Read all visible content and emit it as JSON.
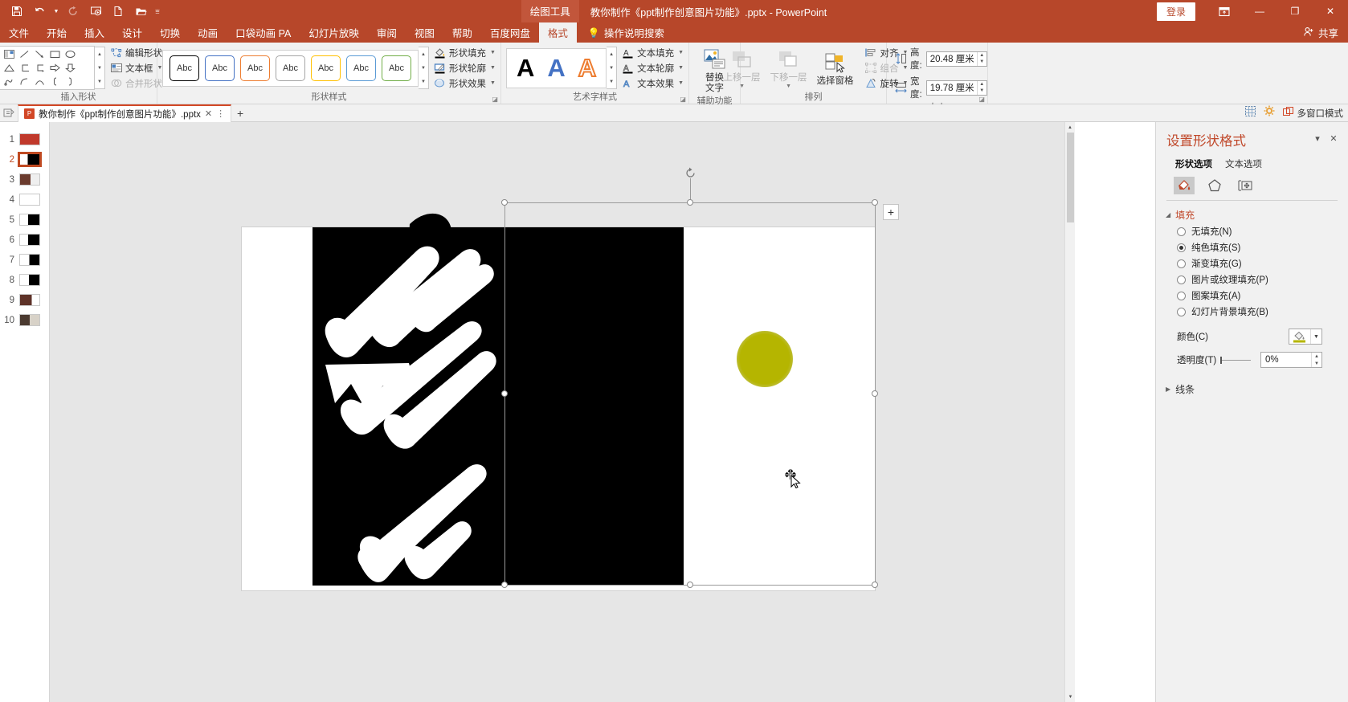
{
  "titlebar": {
    "quick_access": [
      {
        "name": "save-icon",
        "glyph": "save"
      },
      {
        "name": "undo-icon",
        "glyph": "undo"
      },
      {
        "name": "redo-icon",
        "glyph": "redo"
      },
      {
        "name": "start-slideshow-icon",
        "glyph": "slideshow"
      },
      {
        "name": "new-file-icon",
        "glyph": "file"
      },
      {
        "name": "open-folder-icon",
        "glyph": "folder"
      },
      {
        "name": "customize-qat-icon",
        "glyph": "caret"
      }
    ],
    "contextual_tab": "绘图工具",
    "document_title": "教你制作《ppt制作创意图片功能》.pptx  -  PowerPoint",
    "signin": "登录",
    "ribbon_display": "ribbon-options",
    "minimize": "—",
    "restore": "❐",
    "close": "✕"
  },
  "tabs": [
    {
      "label": "文件",
      "active": false
    },
    {
      "label": "开始",
      "active": false
    },
    {
      "label": "插入",
      "active": false
    },
    {
      "label": "设计",
      "active": false
    },
    {
      "label": "切换",
      "active": false
    },
    {
      "label": "动画",
      "active": false
    },
    {
      "label": "口袋动画 PA",
      "active": false
    },
    {
      "label": "幻灯片放映",
      "active": false
    },
    {
      "label": "审阅",
      "active": false
    },
    {
      "label": "视图",
      "active": false
    },
    {
      "label": "帮助",
      "active": false
    },
    {
      "label": "百度网盘",
      "active": false
    },
    {
      "label": "格式",
      "active": true
    }
  ],
  "tellme": "操作说明搜索",
  "share": "共享",
  "ribbon": {
    "groups": {
      "insert_shapes": {
        "label": "插入形状",
        "commands": [
          {
            "label": "编辑形状",
            "disabled": false,
            "caret": true
          },
          {
            "label": "文本框",
            "disabled": false,
            "caret": true
          },
          {
            "label": "合并形状",
            "disabled": true,
            "caret": true
          }
        ]
      },
      "shape_styles": {
        "label": "形状样式",
        "swatches": [
          {
            "text": "Abc",
            "color": "#000000"
          },
          {
            "text": "Abc",
            "color": "#4472c4"
          },
          {
            "text": "Abc",
            "color": "#ed7d31"
          },
          {
            "text": "Abc",
            "color": "#a5a5a5"
          },
          {
            "text": "Abc",
            "color": "#ffc000"
          },
          {
            "text": "Abc",
            "color": "#5b9bd5"
          },
          {
            "text": "Abc",
            "color": "#70ad47"
          }
        ],
        "commands": [
          {
            "label": "形状填充",
            "caret": true
          },
          {
            "label": "形状轮廓",
            "caret": true
          },
          {
            "label": "形状效果",
            "caret": true
          }
        ]
      },
      "wordart_styles": {
        "label": "艺术字样式",
        "swatches": [
          {
            "text": "A",
            "color": "#000000"
          },
          {
            "text": "A",
            "color": "#4472c4"
          },
          {
            "text": "A",
            "color": "#ed7d31"
          }
        ],
        "commands": [
          {
            "label": "文本填充",
            "caret": true
          },
          {
            "label": "文本轮廓",
            "caret": true
          },
          {
            "label": "文本效果",
            "caret": true
          }
        ]
      },
      "accessibility": {
        "label": "辅助功能",
        "button": "替换\n文字",
        "button_line1": "替换",
        "button_line2": "文字"
      },
      "arrange": {
        "label": "排列",
        "bring_forward": "上移一层",
        "bring_forward_disabled": true,
        "send_backward": "下移一层",
        "send_backward_disabled": true,
        "selection_pane": "选择窗格",
        "align": "对齐",
        "group": "组合",
        "group_disabled": true,
        "rotate": "旋转"
      },
      "size": {
        "label": "大小",
        "height_label": "高度:",
        "height_value": "20.48 厘米",
        "width_label": "宽度:",
        "width_value": "19.78 厘米"
      }
    }
  },
  "docstrip": {
    "tab_title": "教你制作《ppt制作创意图片功能》.pptx",
    "close": "✕",
    "more": "⋮",
    "new_tab": "+",
    "multi_window_mode": "多窗口模式"
  },
  "thumbnails": [
    {
      "number": "1",
      "selected": false,
      "style": "red"
    },
    {
      "number": "2",
      "selected": true,
      "style": "blackwhite"
    },
    {
      "number": "3",
      "selected": false,
      "style": "photo"
    },
    {
      "number": "4",
      "selected": false,
      "style": "blank"
    },
    {
      "number": "5",
      "selected": false,
      "style": "blackwhite"
    },
    {
      "number": "6",
      "selected": false,
      "style": "blackwhite"
    },
    {
      "number": "7",
      "selected": false,
      "style": "blackwhite"
    },
    {
      "number": "8",
      "selected": false,
      "style": "blackwhite"
    },
    {
      "number": "9",
      "selected": false,
      "style": "photo"
    },
    {
      "number": "10",
      "selected": false,
      "style": "photo"
    }
  ],
  "pane": {
    "title": "设置形状格式",
    "dropdown": "▾",
    "close": "✕",
    "tabs": [
      {
        "label": "形状选项",
        "active": true
      },
      {
        "label": "文本选项",
        "active": false
      }
    ],
    "icon_tabs": [
      {
        "name": "fill-line-icon",
        "active": true
      },
      {
        "name": "effects-pentagon-icon",
        "active": false
      },
      {
        "name": "size-properties-icon",
        "active": false
      }
    ],
    "fill": {
      "section_label": "填充",
      "options": [
        {
          "label": "无填充(N)",
          "key": "N",
          "selected": false
        },
        {
          "label": "纯色填充(S)",
          "key": "S",
          "selected": true
        },
        {
          "label": "渐变填充(G)",
          "key": "G",
          "selected": false
        },
        {
          "label": "图片或纹理填充(P)",
          "key": "P",
          "selected": false
        },
        {
          "label": "图案填充(A)",
          "key": "A",
          "selected": false
        },
        {
          "label": "幻灯片背景填充(B)",
          "key": "B",
          "selected": false
        }
      ],
      "color_label": "颜色(C)",
      "color_value": "#b5b500",
      "transparency_label": "透明度(T)",
      "transparency_value": "0%"
    },
    "line": {
      "section_label": "线条"
    }
  },
  "canvas": {
    "shape_fill_color": "#b5b500",
    "artwork_bg": "#000000",
    "slide_bg": "#ffffff",
    "plus_badge": "+"
  }
}
